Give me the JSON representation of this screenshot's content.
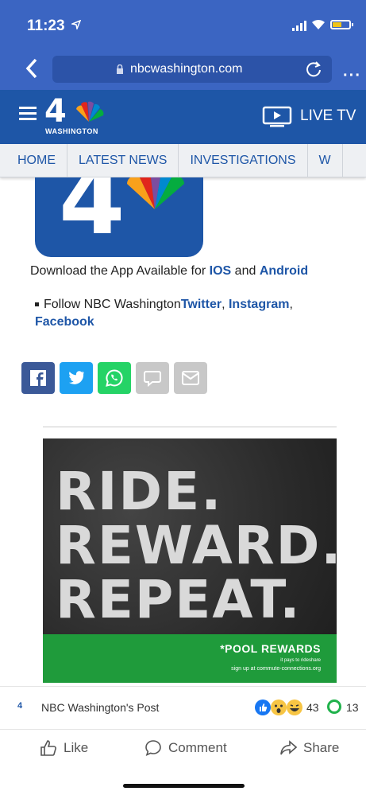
{
  "status": {
    "time": "11:23"
  },
  "browser": {
    "url": "nbcwashington.com",
    "more": "···"
  },
  "header": {
    "logo_number": "4",
    "logo_text": "WASHINGTON",
    "live_tv": "LIVE TV"
  },
  "nav": [
    "HOME",
    "LATEST NEWS",
    "INVESTIGATIONS",
    "W"
  ],
  "app_promo": {
    "text": "Download the App Available for",
    "ios": "IOS",
    "and": "and",
    "android": "Android"
  },
  "follow": {
    "text": "Follow NBC Washington",
    "twitter": "Twitter",
    "instagram": "Instagram",
    "facebook": "Facebook"
  },
  "ad": {
    "line1": "RIDE.",
    "line2": "REWARD.",
    "line3": "REPEAT.",
    "brand": "*POOL REWARDS",
    "sub1": "it pays to rideshare",
    "sub2": "sign up at commute-connections.org"
  },
  "fb": {
    "page_logo": "4",
    "title": "NBC Washington's Post",
    "reactions": "43",
    "comments": "13",
    "like": "Like",
    "comment": "Comment",
    "share": "Share"
  },
  "colors": {
    "browser_blue": "#3b65c2",
    "nbc_blue": "#1e56a7",
    "facebook": "#3b5998",
    "twitter": "#1da1f2",
    "whatsapp": "#25d366",
    "ad_green": "#1f9b3b"
  }
}
